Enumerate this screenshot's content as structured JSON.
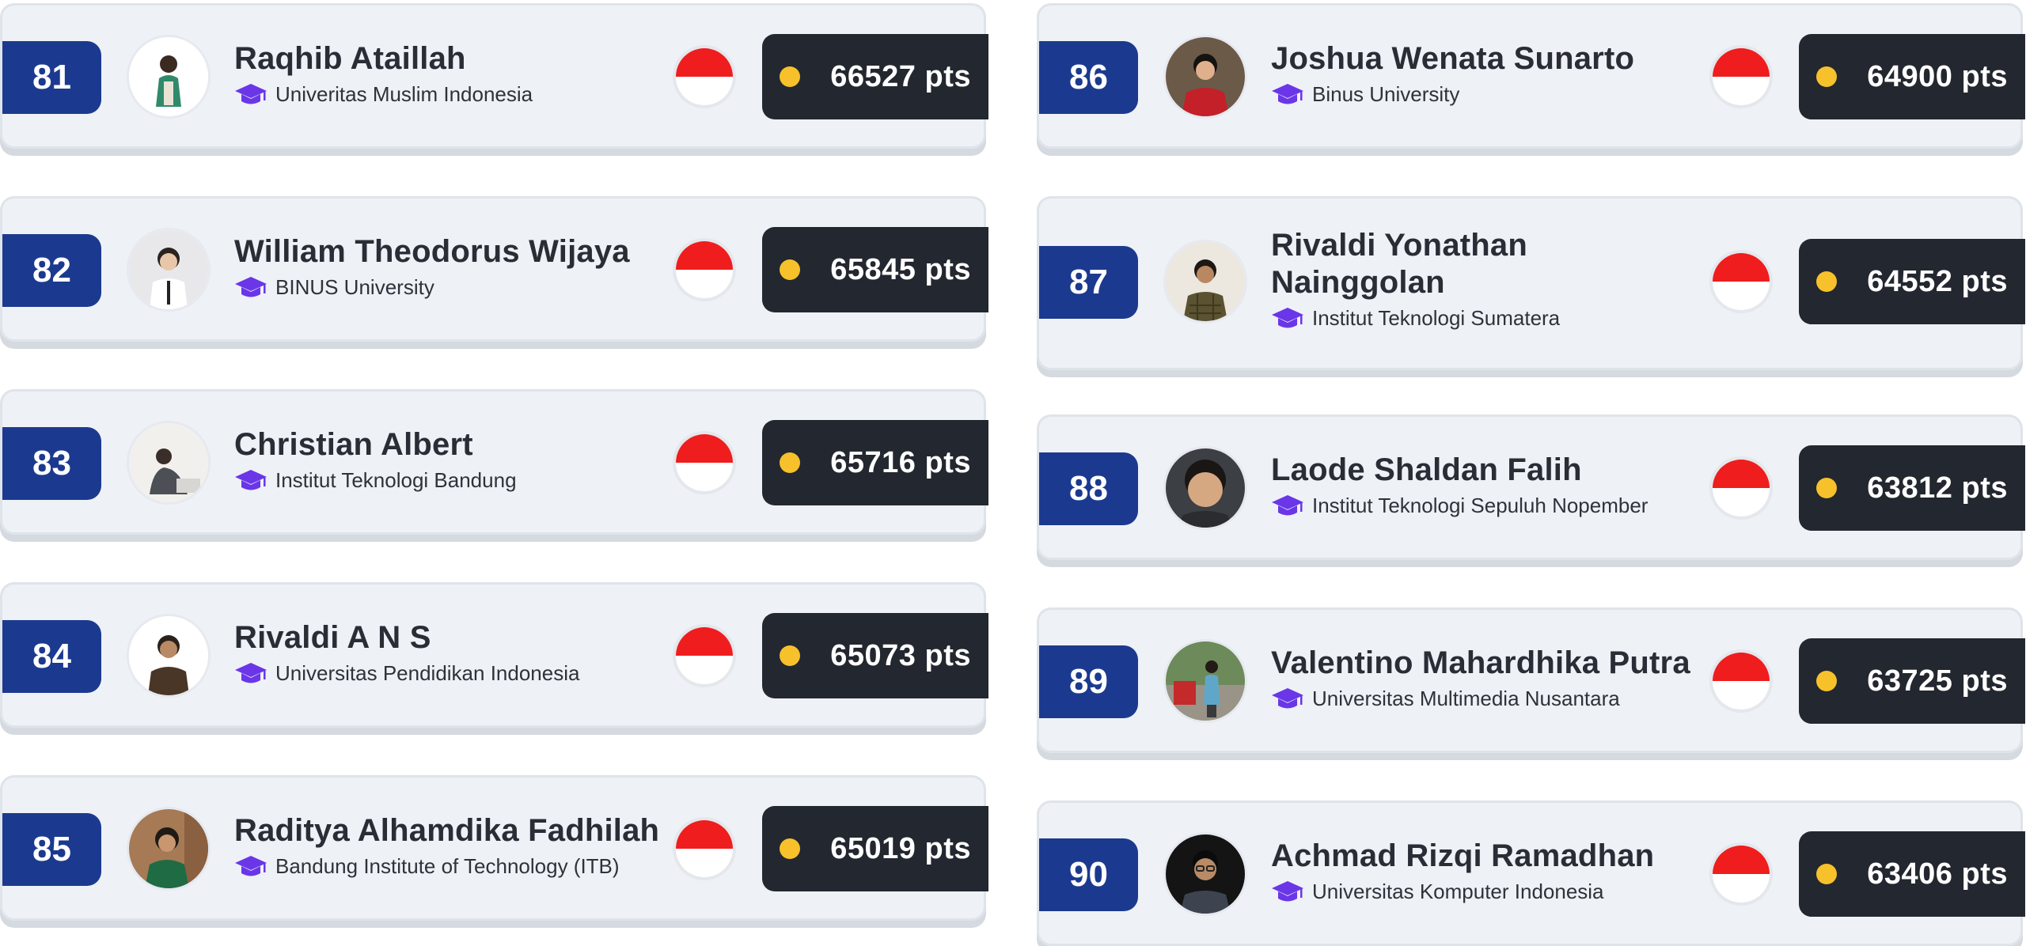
{
  "leaderboard": {
    "left": [
      {
        "rank": "81",
        "name": "Raqhib Ataillah",
        "university": "Univeritas Muslim Indonesia",
        "points": "66527 pts",
        "avatar": "avatar-green-jacket"
      },
      {
        "rank": "82",
        "name": "William Theodorus Wijaya",
        "university": "BINUS University",
        "points": "65845 pts",
        "avatar": "avatar-white-shirt"
      },
      {
        "rank": "83",
        "name": "Christian Albert",
        "university": "Institut Teknologi Bandung",
        "points": "65716 pts",
        "avatar": "avatar-seated"
      },
      {
        "rank": "84",
        "name": "Rivaldi A N S",
        "university": "Universitas Pendidikan Indonesia",
        "points": "65073 pts",
        "avatar": "avatar-brown-shirt"
      },
      {
        "rank": "85",
        "name": "Raditya Alhamdika Fadhilah",
        "university": "Bandung Institute of Technology (ITB)",
        "points": "65019 pts",
        "avatar": "avatar-green-shirt"
      }
    ],
    "right": [
      {
        "rank": "86",
        "name": "Joshua Wenata Sunarto",
        "university": "Binus University",
        "points": "64900 pts",
        "avatar": "avatar-red-shirt"
      },
      {
        "rank": "87",
        "name": "Rivaldi Yonathan Nainggolan",
        "university": "Institut Teknologi Sumatera",
        "points": "64552 pts",
        "avatar": "avatar-plaid-shirt"
      },
      {
        "rank": "88",
        "name": "Laode Shaldan Falih",
        "university": "Institut Teknologi Sepuluh Nopember",
        "points": "63812 pts",
        "avatar": "avatar-closeup"
      },
      {
        "rank": "89",
        "name": "Valentino Mahardhika Putra",
        "university": "Universitas Multimedia Nusantara",
        "points": "63725 pts",
        "avatar": "avatar-outdoor"
      },
      {
        "rank": "90",
        "name": "Achmad Rizqi Ramadhan",
        "university": "Universitas Komputer Indonesia",
        "points": "63406 pts",
        "avatar": "avatar-dark-bg"
      }
    ]
  },
  "icons": {
    "university": "graduation-cap-icon",
    "country": "indonesia-flag-icon",
    "points": "coin-dot-icon"
  },
  "colors": {
    "rank_badge": "#1b3a8f",
    "card_bg": "#eef1f6",
    "points_bg": "#23272f",
    "coin": "#f6c12b",
    "cap_icon": "#6a36e8",
    "flag_red": "#ef1d1d"
  }
}
